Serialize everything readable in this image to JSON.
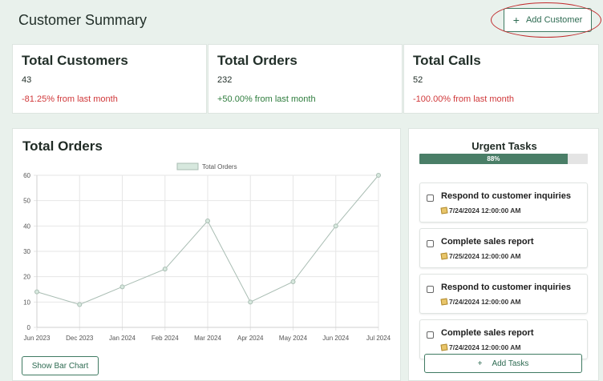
{
  "header": {
    "title": "Customer Summary",
    "add_customer_label": "Add Customer",
    "add_customer_icon": "+"
  },
  "stats": [
    {
      "label": "Total Customers",
      "value": "43",
      "change": "-81.25% from last month",
      "trend": "neg"
    },
    {
      "label": "Total Orders",
      "value": "232",
      "change": "+50.00% from last month",
      "trend": "pos"
    },
    {
      "label": "Total Calls",
      "value": "52",
      "change": "-100.00% from last month",
      "trend": "neg"
    }
  ],
  "orders_panel": {
    "title": "Total Orders",
    "toggle_label": "Show Bar Chart"
  },
  "chart_data": {
    "type": "line",
    "categories": [
      "Jun 2023",
      "Dec 2023",
      "Jan 2024",
      "Feb 2024",
      "Mar 2024",
      "Apr 2024",
      "May 2024",
      "Jun 2024",
      "Jul 2024"
    ],
    "series": [
      {
        "name": "Total Orders",
        "values": [
          14,
          9,
          16,
          23,
          42,
          10,
          18,
          40,
          60
        ]
      }
    ],
    "y_ticks": [
      0,
      10,
      20,
      30,
      40,
      50,
      60
    ],
    "ylim": [
      0,
      60
    ],
    "grid": true,
    "legend": "top",
    "line_color": "#a9bdb3",
    "legend_fill": "#d7e8de"
  },
  "tasks": {
    "title": "Urgent Tasks",
    "progress": 88,
    "progress_label": "88%",
    "items": [
      {
        "title": "Respond to customer inquiries",
        "date": "7/24/2024 12:00:00 AM"
      },
      {
        "title": "Complete sales report",
        "date": "7/25/2024 12:00:00 AM"
      },
      {
        "title": "Respond to customer inquiries",
        "date": "7/24/2024 12:00:00 AM"
      },
      {
        "title": "Complete sales report",
        "date": "7/24/2024 12:00:00 AM"
      }
    ],
    "add_label": "Add Tasks",
    "add_icon": "+"
  },
  "colors": {
    "accent": "#3f7a62",
    "negative": "#d0383a",
    "positive": "#2f7d3e",
    "annotation": "#c0292b"
  }
}
